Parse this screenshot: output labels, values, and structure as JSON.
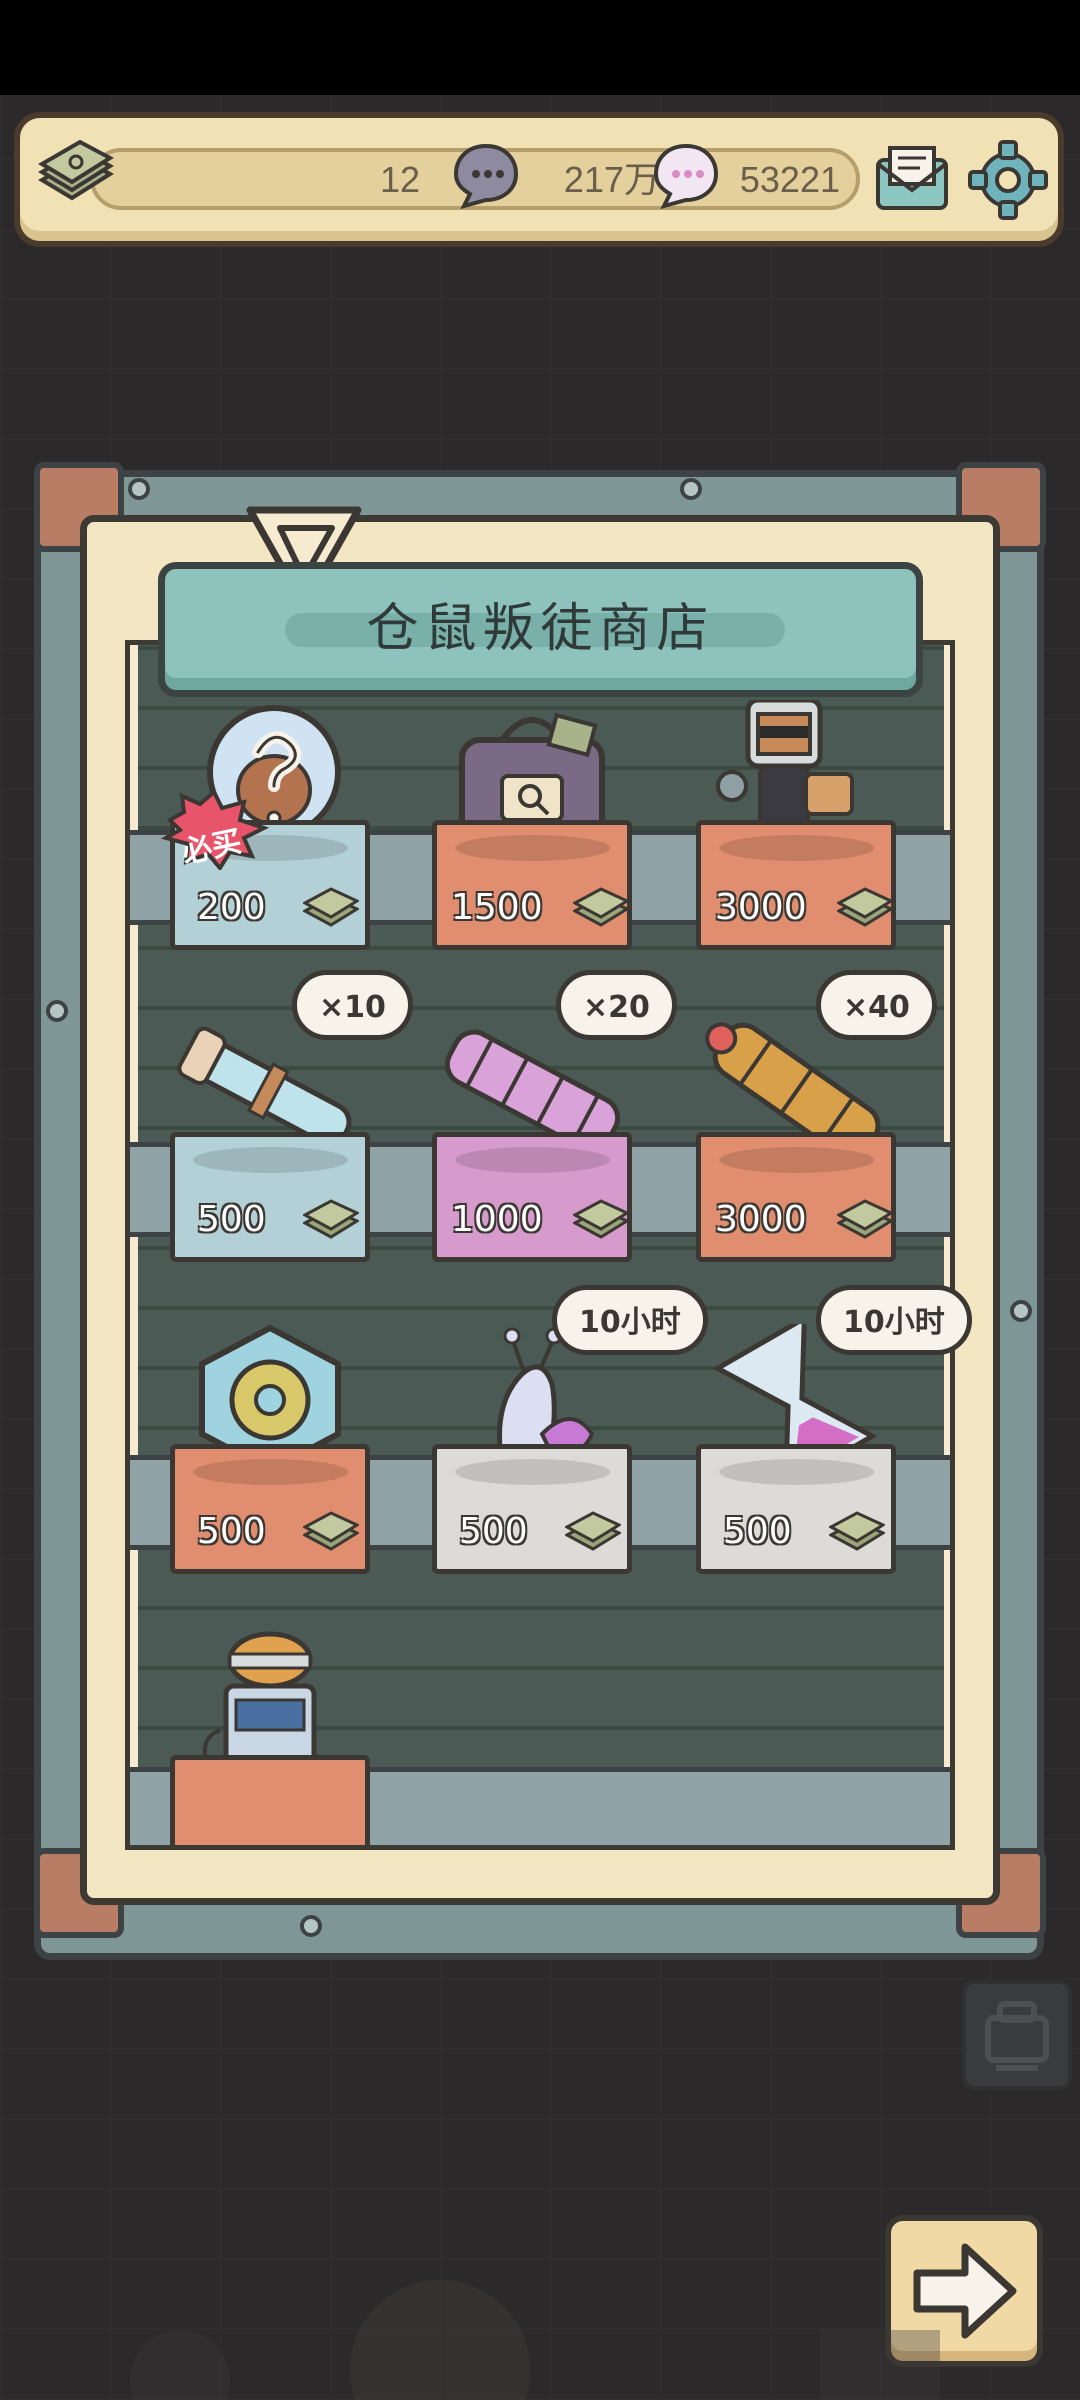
{
  "topbar": {
    "cash_value": "12",
    "bubble_value": "217万",
    "chat_value": "53221",
    "icons": [
      "cash-stack-icon",
      "speech-bubble-icon",
      "chat-bubble-icon",
      "mail-icon",
      "gear-icon"
    ]
  },
  "shop": {
    "title": "仓鼠叛徒商店",
    "must_buy_badge": "必买",
    "items": [
      {
        "name": "mystery-hamster",
        "price": "200",
        "pedestal": "blue",
        "bubble": ""
      },
      {
        "name": "evidence-bag",
        "price": "1500",
        "pedestal": "orange",
        "bubble": ""
      },
      {
        "name": "agent-hamster",
        "price": "3000",
        "pedestal": "orange",
        "bubble": ""
      },
      {
        "name": "scroll-pack",
        "price": "500",
        "pedestal": "blue",
        "bubble": "×10"
      },
      {
        "name": "pink-scroll-pack",
        "price": "1000",
        "pedestal": "pink",
        "bubble": "×20"
      },
      {
        "name": "gold-scroll-pack",
        "price": "3000",
        "pedestal": "orange",
        "bubble": "×40"
      },
      {
        "name": "gear-crystal",
        "price": "500",
        "pedestal": "orange",
        "bubble": ""
      },
      {
        "name": "snail-boost",
        "price": "500",
        "pedestal": "grey",
        "bubble": "10小时"
      },
      {
        "name": "hourglass-boost",
        "price": "500",
        "pedestal": "grey",
        "bubble": "10小时"
      }
    ]
  },
  "colors": {
    "background": "#2b292a",
    "banner": "#8ec2bc",
    "paper": "#f3e6c2",
    "frame": "#7e9696"
  }
}
